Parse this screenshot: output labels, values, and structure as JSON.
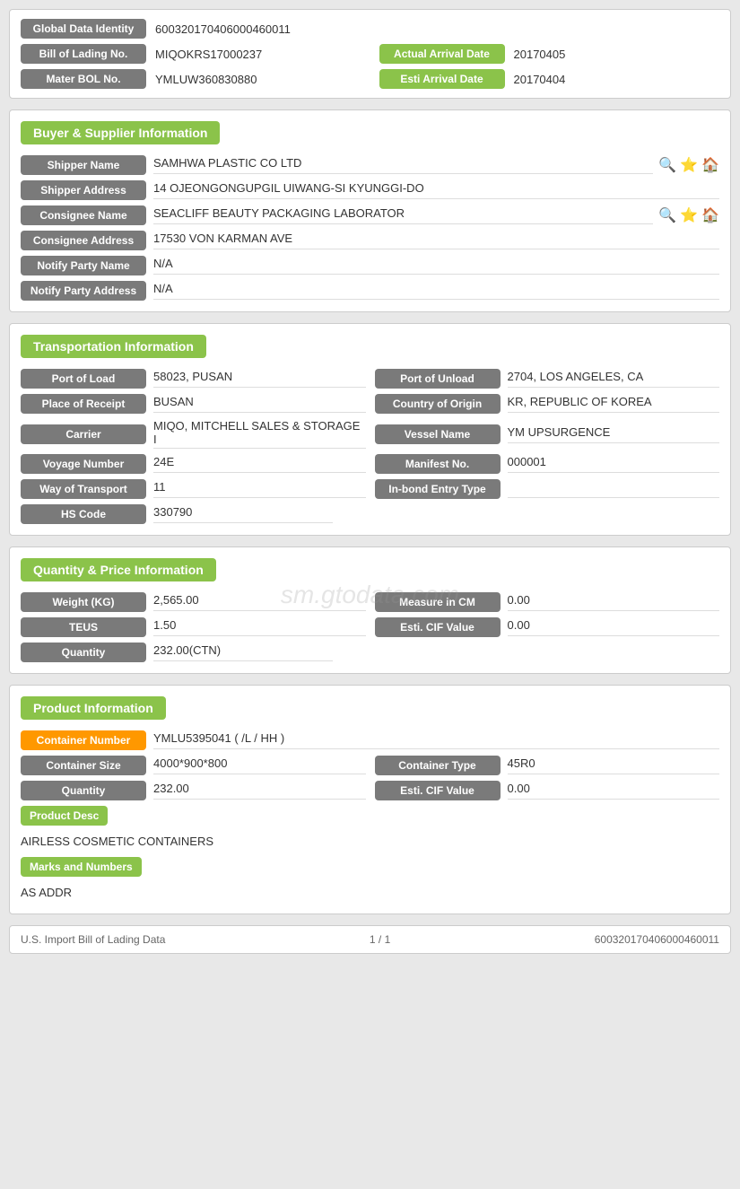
{
  "top": {
    "global_data_identity_label": "Global Data Identity",
    "global_data_identity_value": "600320170406000460011",
    "bill_of_lading_label": "Bill of Lading No.",
    "bill_of_lading_value": "MIQOKRS17000237",
    "actual_arrival_date_label": "Actual Arrival Date",
    "actual_arrival_date_value": "20170405",
    "mater_bol_label": "Mater BOL No.",
    "mater_bol_value": "YMLUW360830880",
    "esti_arrival_date_label": "Esti Arrival Date",
    "esti_arrival_date_value": "20170404"
  },
  "buyer_supplier": {
    "section_title": "Buyer & Supplier Information",
    "shipper_name_label": "Shipper Name",
    "shipper_name_value": "SAMHWA PLASTIC CO LTD",
    "shipper_address_label": "Shipper Address",
    "shipper_address_value": "14 OJEONGONGUPGIL UIWANG-SI KYUNGGI-DO",
    "consignee_name_label": "Consignee Name",
    "consignee_name_value": "SEACLIFF BEAUTY PACKAGING LABORATOR",
    "consignee_address_label": "Consignee Address",
    "consignee_address_value": "17530 VON KARMAN AVE",
    "notify_party_name_label": "Notify Party Name",
    "notify_party_name_value": "N/A",
    "notify_party_address_label": "Notify Party Address",
    "notify_party_address_value": "N/A"
  },
  "transportation": {
    "section_title": "Transportation Information",
    "port_of_load_label": "Port of Load",
    "port_of_load_value": "58023, PUSAN",
    "port_of_unload_label": "Port of Unload",
    "port_of_unload_value": "2704, LOS ANGELES, CA",
    "place_of_receipt_label": "Place of Receipt",
    "place_of_receipt_value": "BUSAN",
    "country_of_origin_label": "Country of Origin",
    "country_of_origin_value": "KR, REPUBLIC OF KOREA",
    "carrier_label": "Carrier",
    "carrier_value": "MIQO, MITCHELL SALES & STORAGE I",
    "vessel_name_label": "Vessel Name",
    "vessel_name_value": "YM UPSURGENCE",
    "voyage_number_label": "Voyage Number",
    "voyage_number_value": "24E",
    "manifest_no_label": "Manifest No.",
    "manifest_no_value": "000001",
    "way_of_transport_label": "Way of Transport",
    "way_of_transport_value": "11",
    "in_bond_entry_type_label": "In-bond Entry Type",
    "in_bond_entry_type_value": "",
    "hs_code_label": "HS Code",
    "hs_code_value": "330790"
  },
  "quantity_price": {
    "section_title": "Quantity & Price Information",
    "weight_label": "Weight (KG)",
    "weight_value": "2,565.00",
    "measure_in_cm_label": "Measure in CM",
    "measure_in_cm_value": "0.00",
    "teus_label": "TEUS",
    "teus_value": "1.50",
    "esti_cif_value_label": "Esti. CIF Value",
    "esti_cif_value": "0.00",
    "quantity_label": "Quantity",
    "quantity_value": "232.00(CTN)"
  },
  "product": {
    "section_title": "Product Information",
    "container_number_label": "Container Number",
    "container_number_value": "YMLU5395041 ( /L / HH )",
    "container_size_label": "Container Size",
    "container_size_value": "4000*900*800",
    "container_type_label": "Container Type",
    "container_type_value": "45R0",
    "quantity_label": "Quantity",
    "quantity_value": "232.00",
    "esti_cif_label": "Esti. CIF Value",
    "esti_cif_value": "0.00",
    "product_desc_label": "Product Desc",
    "product_desc_value": "AIRLESS COSMETIC CONTAINERS",
    "marks_and_numbers_label": "Marks and Numbers",
    "marks_and_numbers_value": "AS ADDR"
  },
  "footer": {
    "left": "U.S. Import Bill of Lading Data",
    "center": "1 / 1",
    "right": "600320170406000460011"
  },
  "watermark": "sm.gtodata.com"
}
